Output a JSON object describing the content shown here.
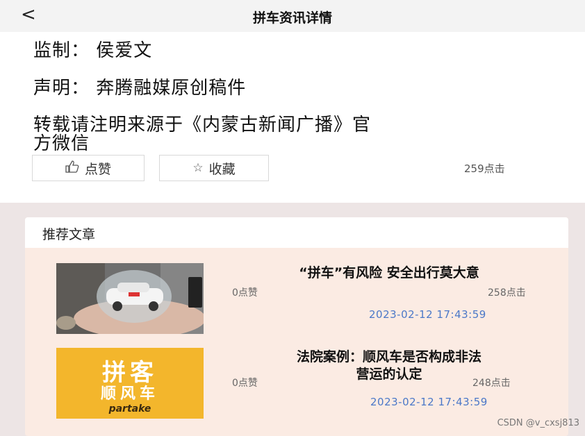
{
  "header": {
    "back_icon": "chevron-left-icon",
    "back_glyph": "<",
    "title": "拼车资讯详情"
  },
  "article": {
    "supervisor": "监制： 侯爱文",
    "statement": "声明： 奔腾融媒原创稿件",
    "reprint_line1": "转载请注明来源于《内蒙古新闻广播》官",
    "reprint_line2": "方微信"
  },
  "actions": {
    "like_icon": "thumbs-up-icon",
    "like_label": "点赞",
    "favorite_icon": "star-icon",
    "favorite_label": "收藏",
    "views": "259点击"
  },
  "recommend": {
    "heading": "推荐文章",
    "items": [
      {
        "title_line1": "“拼车”有风险 安全出行莫大意",
        "title_line2": "",
        "likes": "0点赞",
        "clicks": "258点击",
        "date": "2023-02-12 17:43:59",
        "image_icon": "car-in-hands-image"
      },
      {
        "title_line1": "法院案例：顺风车是否构成非法",
        "title_line2": "营运的认定",
        "likes": "0点赞",
        "clicks": "248点击",
        "date": "2023-02-12 17:43:59",
        "image_icon": "rideshare-logo-image",
        "image_text_1": "拼客",
        "image_text_2": "顺风车",
        "image_text_3": "partake"
      }
    ]
  },
  "watermark": "CSDN @v_cxsj813",
  "colors": {
    "topbar": "#f3f3f3",
    "card_bg": "#fbebe3",
    "date_blue": "#4b78c8",
    "page_bg": "#ede5e5",
    "logo_yellow": "#f3b62c"
  }
}
